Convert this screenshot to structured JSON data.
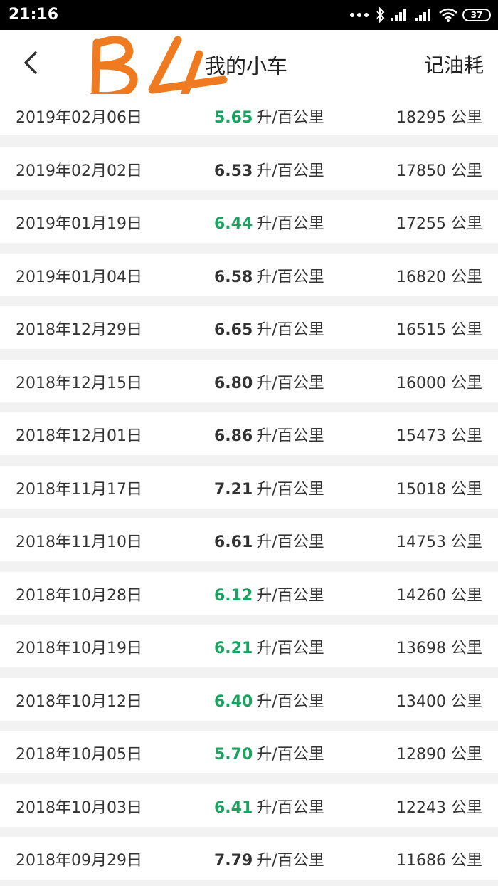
{
  "status_bar": {
    "time": "21:16",
    "battery": "37"
  },
  "header": {
    "title": "我的小车",
    "action": "记油耗",
    "logo_text": "B4"
  },
  "colors": {
    "good": "#1aa260",
    "normal": "#333333"
  },
  "units": {
    "consumption": "升/百公里",
    "distance": "公里"
  },
  "records": [
    {
      "date": "2019年02月06日",
      "consumption": "5.65",
      "good": true,
      "odometer": "18295"
    },
    {
      "date": "2019年02月02日",
      "consumption": "6.53",
      "good": false,
      "odometer": "17850"
    },
    {
      "date": "2019年01月19日",
      "consumption": "6.44",
      "good": true,
      "odometer": "17255"
    },
    {
      "date": "2019年01月04日",
      "consumption": "6.58",
      "good": false,
      "odometer": "16820"
    },
    {
      "date": "2018年12月29日",
      "consumption": "6.65",
      "good": false,
      "odometer": "16515"
    },
    {
      "date": "2018年12月15日",
      "consumption": "6.80",
      "good": false,
      "odometer": "16000"
    },
    {
      "date": "2018年12月01日",
      "consumption": "6.86",
      "good": false,
      "odometer": "15473"
    },
    {
      "date": "2018年11月17日",
      "consumption": "7.21",
      "good": false,
      "odometer": "15018"
    },
    {
      "date": "2018年11月10日",
      "consumption": "6.61",
      "good": false,
      "odometer": "14753"
    },
    {
      "date": "2018年10月28日",
      "consumption": "6.12",
      "good": true,
      "odometer": "14260"
    },
    {
      "date": "2018年10月19日",
      "consumption": "6.21",
      "good": true,
      "odometer": "13698"
    },
    {
      "date": "2018年10月12日",
      "consumption": "6.40",
      "good": true,
      "odometer": "13400"
    },
    {
      "date": "2018年10月05日",
      "consumption": "5.70",
      "good": true,
      "odometer": "12890"
    },
    {
      "date": "2018年10月03日",
      "consumption": "6.41",
      "good": true,
      "odometer": "12243"
    },
    {
      "date": "2018年09月29日",
      "consumption": "7.79",
      "good": false,
      "odometer": "11686"
    }
  ]
}
